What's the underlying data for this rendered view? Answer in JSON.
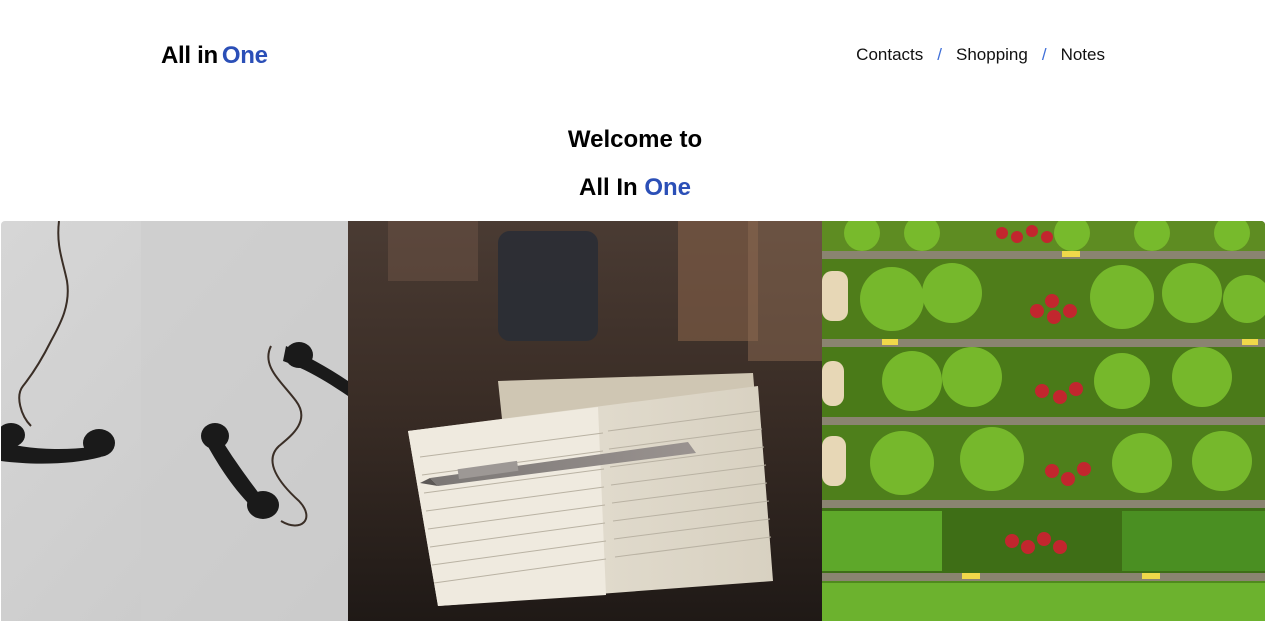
{
  "header": {
    "logo_main": "All in",
    "logo_accent": "One",
    "nav": [
      {
        "label": "Contacts"
      },
      {
        "label": "Shopping"
      },
      {
        "label": "Notes"
      }
    ],
    "separator": "/"
  },
  "hero": {
    "line1": "Welcome to",
    "line2_main": "All In",
    "line2_accent": "One"
  },
  "gallery": {
    "tiles": [
      {
        "subject": "telephone handsets"
      },
      {
        "subject": "notebook and pen"
      },
      {
        "subject": "grocery vegetable shelves"
      }
    ]
  },
  "colors": {
    "accent": "#2b4fb7",
    "separator": "#3f6fd8"
  }
}
